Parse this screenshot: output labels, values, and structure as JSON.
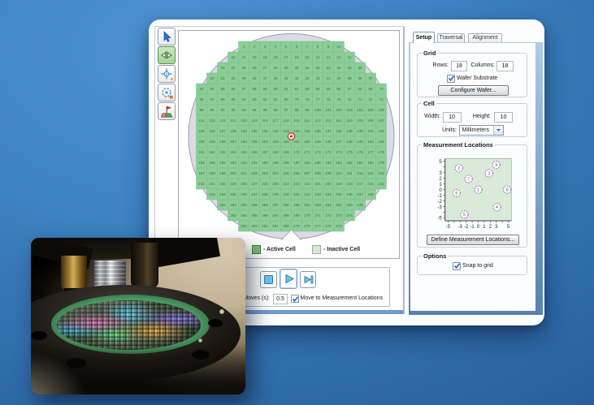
{
  "desktop": {
    "bg_top": "#4e93d3",
    "bg_bottom": "#2a62a0"
  },
  "toolbar": {
    "buttons": [
      {
        "name": "select-cursor",
        "icon": "cursor-arrow-icon",
        "selected": false
      },
      {
        "name": "flip-horizontal",
        "icon": "double-horizontal-arrow-icon",
        "selected": true
      },
      {
        "name": "move-crosshair",
        "icon": "crosshair-icon",
        "selected": false
      },
      {
        "name": "center-target",
        "icon": "dashed-circle-target-icon",
        "selected": false
      },
      {
        "name": "flag-location",
        "icon": "flag-marker-icon",
        "selected": false
      }
    ]
  },
  "wafer_map": {
    "active_color": "#8ccd96",
    "active_border": "#79bd85",
    "number_color": "#3f6e51",
    "wafer_color": "#dadbe7",
    "wafer_border": "#9d9dac",
    "marker_color": "#d03030",
    "rows": [
      {
        "n": 10,
        "from": 1,
        "to": 10
      },
      {
        "n": 12,
        "from": 22,
        "to": 11
      },
      {
        "n": 14,
        "from": 23,
        "to": 36
      },
      {
        "n": 16,
        "from": 52,
        "to": 37
      },
      {
        "n": 18,
        "from": 53,
        "to": 70
      },
      {
        "n": 18,
        "from": 88,
        "to": 71
      },
      {
        "n": 18,
        "from": 89,
        "to": 106
      },
      {
        "n": 18,
        "from": 124,
        "to": 107
      },
      {
        "n": 18,
        "from": 125,
        "to": 142
      },
      {
        "n": 18,
        "from": 160,
        "to": 143
      },
      {
        "n": 18,
        "from": 161,
        "to": 178
      },
      {
        "n": 18,
        "from": 196,
        "to": 179
      },
      {
        "n": 18,
        "from": 197,
        "to": 214
      },
      {
        "n": 18,
        "from": 232,
        "to": 215
      },
      {
        "n": 16,
        "from": 233,
        "to": 248
      },
      {
        "n": 14,
        "from": 262,
        "to": 249
      },
      {
        "n": 12,
        "from": 263,
        "to": 274
      },
      {
        "n": 10,
        "from": 284,
        "to": 275
      }
    ],
    "legend": {
      "active_label": "- Active Cell",
      "inactive_label": "- Inactive Cell",
      "active_swatch": "#72c172",
      "inactive_swatch": "#d7e7d5"
    }
  },
  "transport": {
    "moves_label": "Moves (s):",
    "moves_value": "0.5",
    "move_checkbox_label": "Move to Measurement Locations",
    "move_checked": true
  },
  "panel": {
    "tabs": [
      {
        "label": "Setup",
        "active": true
      },
      {
        "label": "Traversal",
        "active": false
      },
      {
        "label": "Alignment",
        "active": false
      }
    ],
    "grid": {
      "title": "Grid",
      "rows_label": "Rows:",
      "rows_value": "18",
      "columns_label": "Columns:",
      "columns_value": "18",
      "substrate_label": "Wafer Substrate",
      "substrate_checked": true,
      "configure_label": "Configure Wafer..."
    },
    "cell": {
      "title": "Cell",
      "width_label": "Width:",
      "width_value": "10",
      "height_label": "Height:",
      "height_value": "10",
      "units_label": "Units:",
      "units_value": "Millimeters"
    },
    "measurement": {
      "title": "Measurement Locations",
      "define_label": "Define Measurement Locations..."
    },
    "options": {
      "title": "Options",
      "snap_label": "Snap to grid",
      "snap_checked": true
    }
  },
  "chart_data": {
    "type": "scatter",
    "title": "Measurement Locations",
    "xlim": [
      -5.5,
      5.5
    ],
    "ylim": [
      -5.5,
      5.5
    ],
    "x_tick_labels": [
      -5,
      -3,
      -2,
      -1,
      0,
      1,
      2,
      3,
      5
    ],
    "y_tick_labels": [
      5,
      3,
      2,
      1,
      0,
      -1,
      -2,
      -3,
      -5
    ],
    "plot_bg": "#d9ebd8",
    "point_style": "dashed-purple-circle",
    "points": [
      {
        "id": 1,
        "x": 0,
        "y": 0
      },
      {
        "id": 2,
        "x": -3.2,
        "y": 3.8
      },
      {
        "id": 3,
        "x": 1.8,
        "y": 2.9
      },
      {
        "id": 4,
        "x": 3.1,
        "y": -3.1
      },
      {
        "id": 5,
        "x": -2.3,
        "y": -4.4
      },
      {
        "id": 6,
        "x": -3.6,
        "y": -0.6
      },
      {
        "id": 7,
        "x": -1.6,
        "y": 1.9
      },
      {
        "id": 8,
        "x": 4.8,
        "y": 0
      },
      {
        "id": 9,
        "x": 3,
        "y": 4.4
      }
    ]
  }
}
